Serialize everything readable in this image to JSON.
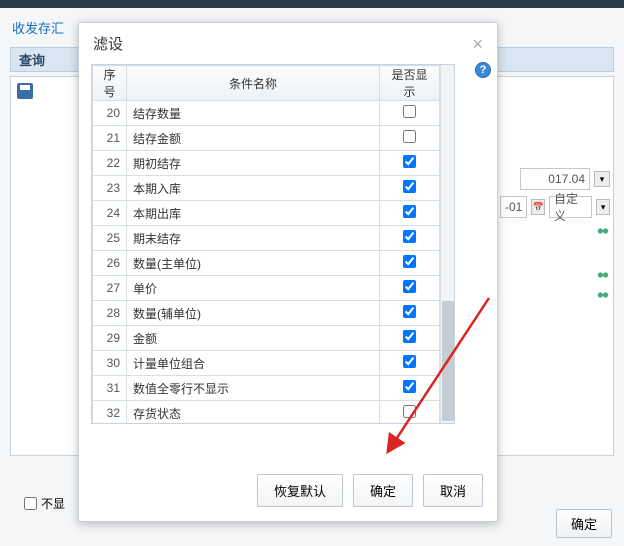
{
  "bg": {
    "link": "收发存汇",
    "query_label": "查询",
    "period_value": "017.04",
    "date_suffix": "-01",
    "custom_label": "自定义",
    "footer_button": "确定",
    "bottom_checkbox_label": "不显"
  },
  "modal": {
    "title": "滤设",
    "columns": {
      "seq": "序号",
      "name": "条件名称",
      "show": "是否显示"
    },
    "rows": [
      {
        "seq": 20,
        "name": "结存数量",
        "checked": false
      },
      {
        "seq": 21,
        "name": "结存金额",
        "checked": false
      },
      {
        "seq": 22,
        "name": "期初结存",
        "checked": true
      },
      {
        "seq": 23,
        "name": "本期入库",
        "checked": true
      },
      {
        "seq": 24,
        "name": "本期出库",
        "checked": true
      },
      {
        "seq": 25,
        "name": "期末结存",
        "checked": true
      },
      {
        "seq": 26,
        "name": "数量(主单位)",
        "checked": true
      },
      {
        "seq": 27,
        "name": "单价",
        "checked": true
      },
      {
        "seq": 28,
        "name": "数量(辅单位)",
        "checked": true
      },
      {
        "seq": 29,
        "name": "金额",
        "checked": true
      },
      {
        "seq": 30,
        "name": "计量单位组合",
        "checked": true
      },
      {
        "seq": 31,
        "name": "数值全零行不显示",
        "checked": true
      },
      {
        "seq": 32,
        "name": "存货状态",
        "checked": false
      }
    ],
    "buttons": {
      "restore": "恢复默认",
      "ok": "确定",
      "cancel": "取消"
    }
  }
}
